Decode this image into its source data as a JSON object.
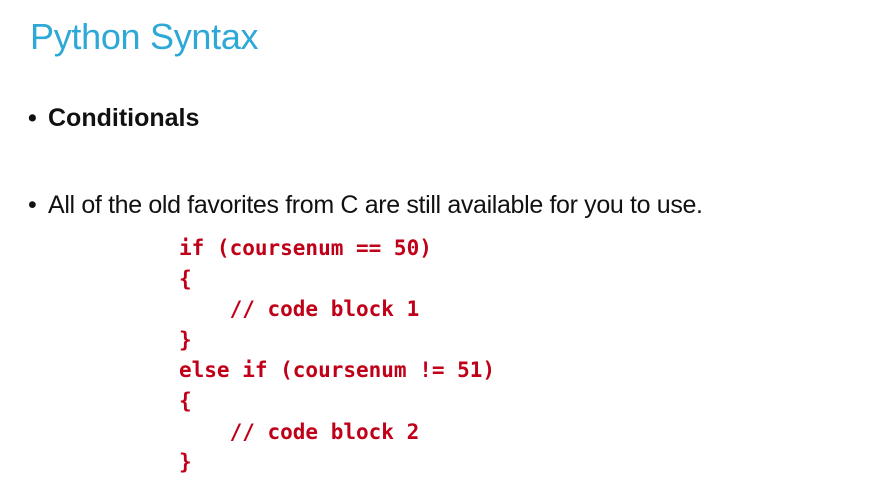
{
  "slide": {
    "title": "Python Syntax",
    "bullets": [
      {
        "marker": "•",
        "text": "Conditionals"
      },
      {
        "marker": "•",
        "text": "All of the old favorites from C are still available for you to use."
      }
    ],
    "code_lines": [
      "if (coursenum == 50)",
      "{",
      "    // code block 1",
      "}",
      "else if (coursenum != 51)",
      "{",
      "    // code block 2",
      "}"
    ],
    "colors": {
      "title": "#2ea8d6",
      "code": "#c00018",
      "text": "#111111",
      "background": "#ffffff"
    }
  }
}
